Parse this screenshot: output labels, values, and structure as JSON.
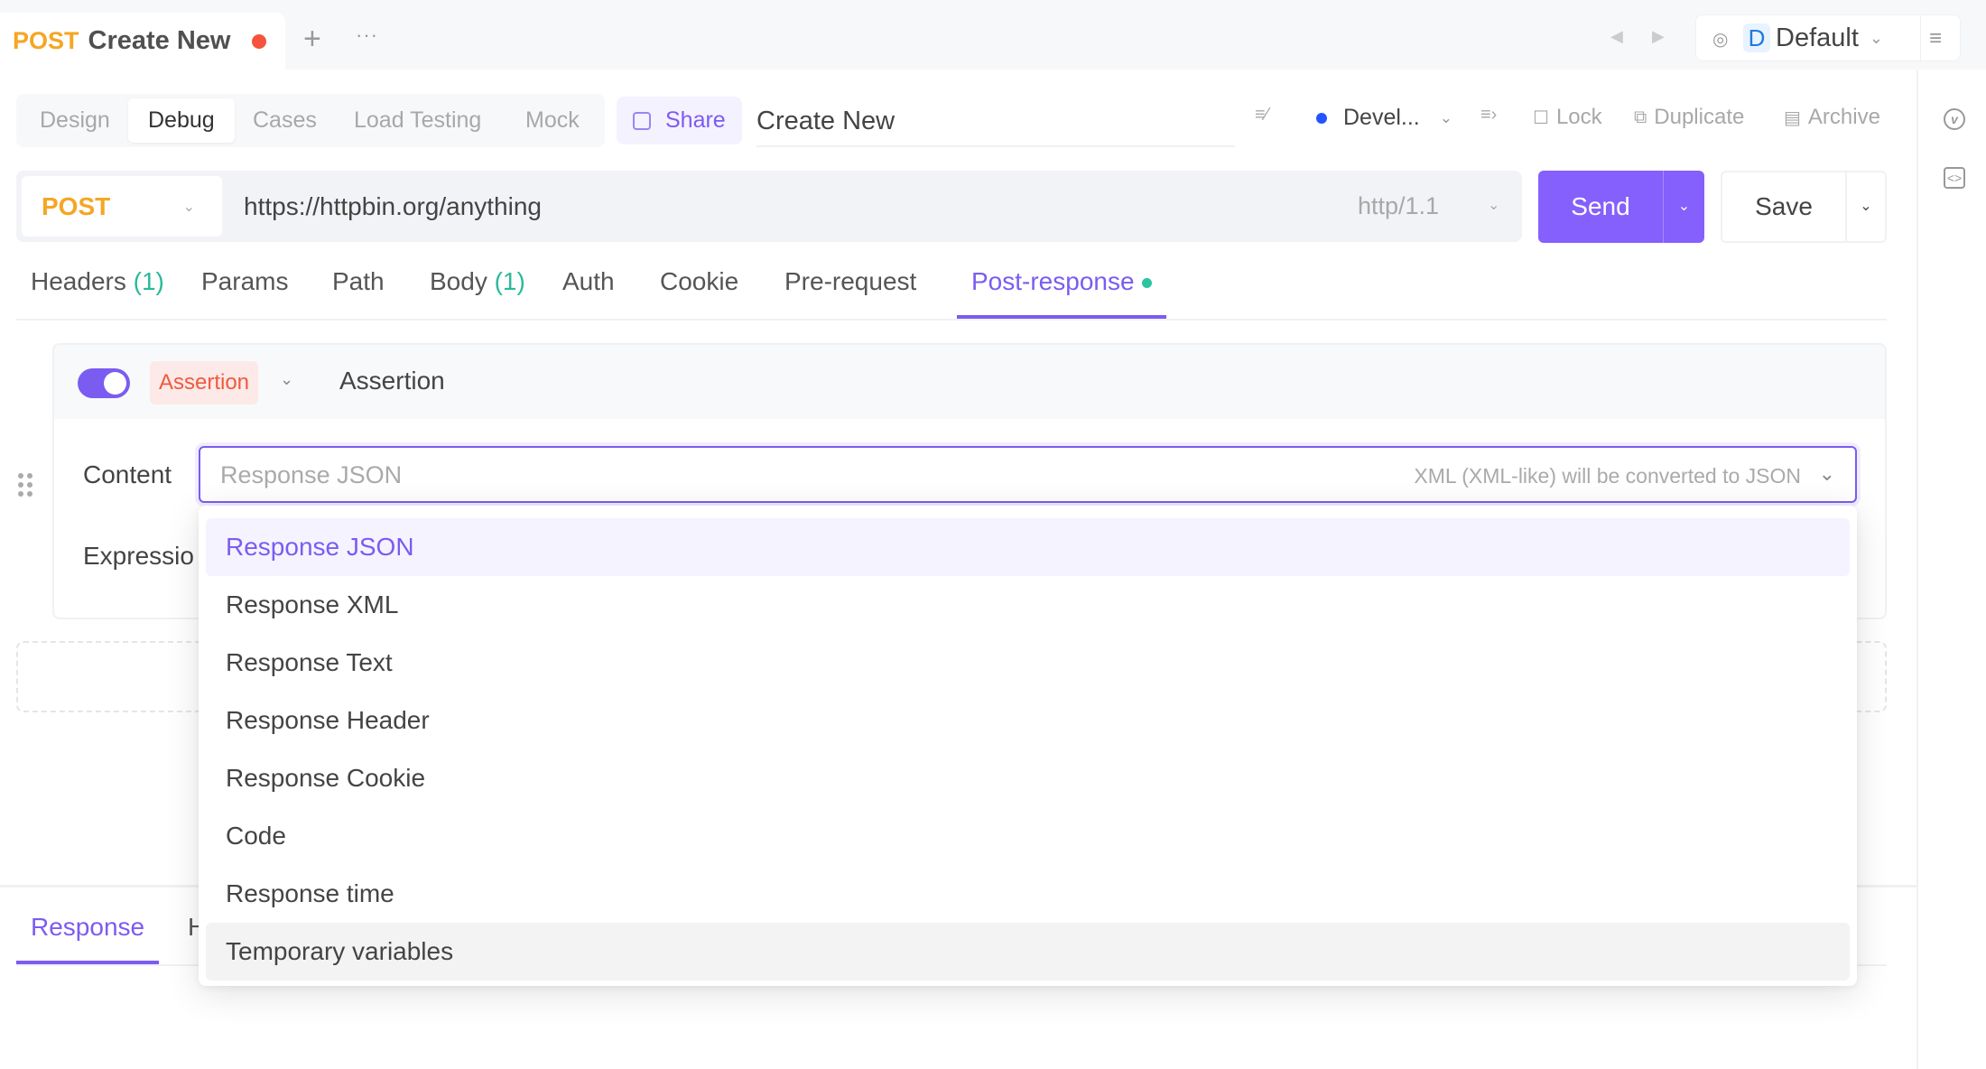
{
  "top_tab": {
    "method": "POST",
    "name": "Create New",
    "unsaved": true
  },
  "top_actions": {
    "add_label": "+",
    "more_label": "···"
  },
  "environment_box": {
    "badge": "D",
    "name": "Default"
  },
  "mode_tabs": [
    {
      "label": "Design",
      "active": false
    },
    {
      "label": "Debug",
      "active": true
    },
    {
      "label": "Cases",
      "active": false
    },
    {
      "label": "Load Testing",
      "active": false
    },
    {
      "label": "Mock",
      "active": false
    }
  ],
  "share_label": "Share",
  "title_value": "Create New",
  "toolbar": {
    "env_label": "Devel...",
    "env_dot_color": "#2454ff",
    "lock_label": "Lock",
    "duplicate_label": "Duplicate",
    "archive_label": "Archive"
  },
  "request": {
    "method": "POST",
    "url": "https://httpbin.org/anything",
    "http_version": "http/1.1",
    "send_label": "Send",
    "save_label": "Save"
  },
  "request_tabs": [
    {
      "label": "Headers",
      "count": "(1)"
    },
    {
      "label": "Params",
      "count": ""
    },
    {
      "label": "Path",
      "count": ""
    },
    {
      "label": "Body",
      "count": "(1)"
    },
    {
      "label": "Auth",
      "count": ""
    },
    {
      "label": "Cookie",
      "count": ""
    },
    {
      "label": "Pre-request",
      "count": ""
    },
    {
      "label": "Post-response",
      "count": "",
      "active": true,
      "indicator": true
    }
  ],
  "assertion": {
    "enabled": true,
    "type_label": "Assertion",
    "name": "Assertion",
    "content_label": "Content",
    "expression_label": "Expressio",
    "content_placeholder": "Response JSON",
    "content_hint": "XML (XML-like) will be converted to JSON"
  },
  "dropdown_options": [
    {
      "label": "Response JSON",
      "state": "selected"
    },
    {
      "label": "Response XML",
      "state": ""
    },
    {
      "label": "Response Text",
      "state": ""
    },
    {
      "label": "Response Header",
      "state": ""
    },
    {
      "label": "Response Cookie",
      "state": ""
    },
    {
      "label": "Code",
      "state": ""
    },
    {
      "label": "Response time",
      "state": ""
    },
    {
      "label": "Temporary variables",
      "state": "hover"
    }
  ],
  "response_tabs": [
    {
      "label": "Response",
      "active": true
    },
    {
      "label": "H",
      "active": false
    }
  ],
  "colors": {
    "accent": "#7b5cf0",
    "send_button": "#8560fc",
    "post_method": "#f5a623",
    "unsaved_dot": "#f5533d",
    "count_green": "#2bb99a",
    "assertion_red": "#ee5a3f"
  }
}
